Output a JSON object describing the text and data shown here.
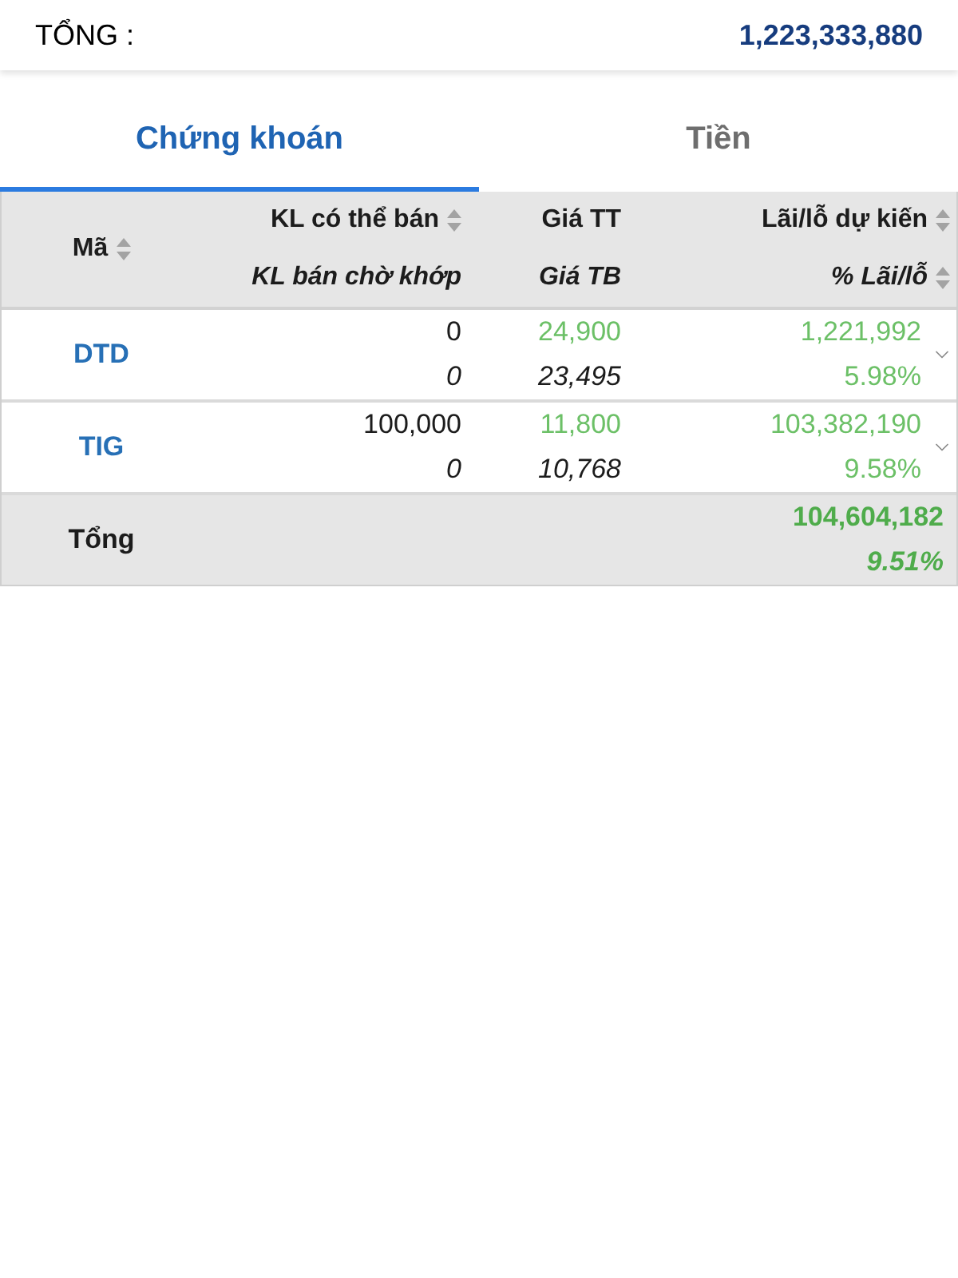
{
  "summary": {
    "label": "TỔNG :",
    "value": "1,223,333,880"
  },
  "tabs": [
    {
      "label": "Chứng khoán",
      "selected": true
    },
    {
      "label": "Tiền",
      "selected": false
    }
  ],
  "table": {
    "columns": [
      {
        "lines": [
          {
            "label": "Mã",
            "sortable": true
          }
        ]
      },
      {
        "lines": [
          {
            "label": "KL có thể bán",
            "sortable": true
          },
          {
            "label": "KL bán chờ khớp",
            "sortable": false
          }
        ]
      },
      {
        "lines": [
          {
            "label": "Giá TT",
            "sortable": false
          },
          {
            "label": "Giá TB",
            "sortable": false
          }
        ]
      },
      {
        "lines": [
          {
            "label": "Lãi/lỗ dự kiến",
            "sortable": true
          },
          {
            "label": "% Lãi/lỗ",
            "sortable": true
          }
        ]
      }
    ],
    "rows": [
      {
        "symbol": "DTD",
        "qty_available": "0",
        "qty_pending": "0",
        "market_price": "24,900",
        "avg_price": "23,495",
        "expected_profit": "1,221,992",
        "profit_pct": "5.98%",
        "expanded": false
      },
      {
        "symbol": "TIG",
        "qty_available": "100,000",
        "qty_pending": "0",
        "market_price": "11,800",
        "avg_price": "10,768",
        "expected_profit": "103,382,190",
        "profit_pct": "9.58%",
        "expanded": false
      }
    ],
    "total": {
      "label": "Tổng",
      "expected_profit": "104,604,182",
      "profit_pct": "9.51%"
    }
  }
}
